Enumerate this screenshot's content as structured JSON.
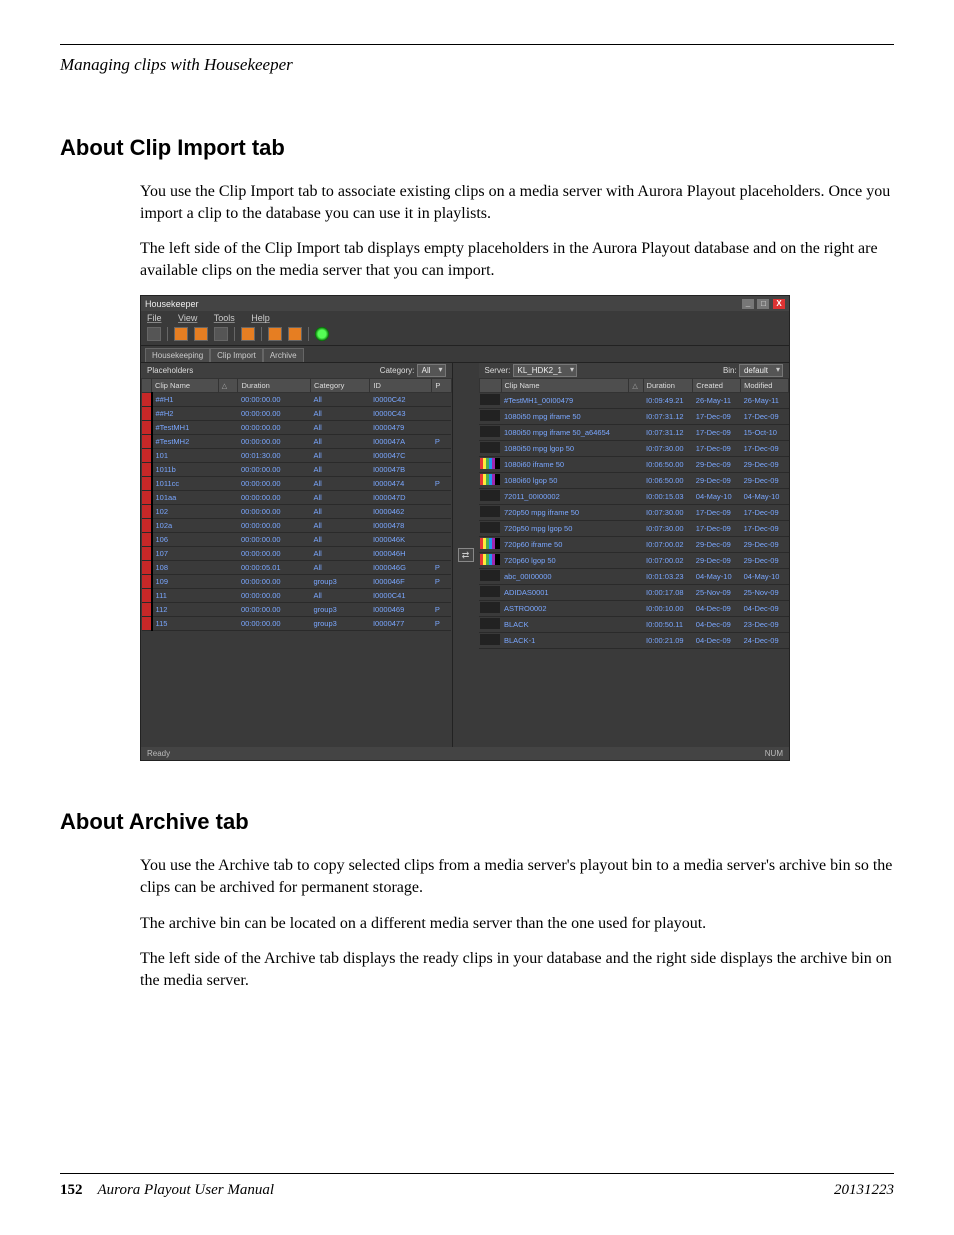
{
  "running_head": "Managing clips with Housekeeper",
  "section1": {
    "title": "About Clip Import tab",
    "p1": "You use the Clip Import tab to associate existing clips on a media server with Aurora Playout placeholders. Once you import a clip to the database you can use it in playlists.",
    "p2": "The left side of the Clip Import tab displays empty placeholders in the Aurora Playout database and on the right are available clips on the media server that you can import."
  },
  "section2": {
    "title": "About Archive tab",
    "p1": "You use the Archive tab to copy selected clips from a media server's playout bin to a media server's archive bin so the clips can be archived for permanent storage.",
    "p2": "The archive bin can be located on a different media server than the one used for playout.",
    "p3": "The left side of the Archive tab displays the ready clips in your database and the right side displays the archive bin on the media server."
  },
  "app": {
    "title": "Housekeeper",
    "menu": [
      "File",
      "View",
      "Tools",
      "Help"
    ],
    "tabs": [
      "Housekeeping",
      "Clip Import",
      "Archive"
    ],
    "left": {
      "label": "Placeholders",
      "category_label": "Category:",
      "category_value": "All",
      "cols": [
        "Clip Name",
        "",
        "Duration",
        "Category",
        "ID",
        "P"
      ],
      "rows": [
        {
          "name": "##H1",
          "dur": "00:00:00.00",
          "cat": "All",
          "id": "I0000C42",
          "p": ""
        },
        {
          "name": "##H2",
          "dur": "00:00:00.00",
          "cat": "All",
          "id": "I0000C43",
          "p": ""
        },
        {
          "name": "#TestMH1",
          "dur": "00:00:00.00",
          "cat": "All",
          "id": "I0000479",
          "p": ""
        },
        {
          "name": "#TestMH2",
          "dur": "00:00:00.00",
          "cat": "All",
          "id": "I000047A",
          "p": "P"
        },
        {
          "name": "101",
          "dur": "00:01:30.00",
          "cat": "All",
          "id": "I000047C",
          "p": ""
        },
        {
          "name": "1011b",
          "dur": "00:00:00.00",
          "cat": "All",
          "id": "I000047B",
          "p": ""
        },
        {
          "name": "1011cc",
          "dur": "00:00:00.00",
          "cat": "All",
          "id": "I0000474",
          "p": "P"
        },
        {
          "name": "101aa",
          "dur": "00:00:00.00",
          "cat": "All",
          "id": "I000047D",
          "p": ""
        },
        {
          "name": "102",
          "dur": "00:00:00.00",
          "cat": "All",
          "id": "I0000462",
          "p": ""
        },
        {
          "name": "102a",
          "dur": "00:00:00.00",
          "cat": "All",
          "id": "I0000478",
          "p": ""
        },
        {
          "name": "106",
          "dur": "00:00:00.00",
          "cat": "All",
          "id": "I000046K",
          "p": ""
        },
        {
          "name": "107",
          "dur": "00:00:00.00",
          "cat": "All",
          "id": "I000046H",
          "p": ""
        },
        {
          "name": "108",
          "dur": "00:00:05.01",
          "cat": "All",
          "id": "I000046G",
          "p": "P"
        },
        {
          "name": "109",
          "dur": "00:00:00.00",
          "cat": "group3",
          "id": "I000046F",
          "p": "P"
        },
        {
          "name": "111",
          "dur": "00:00:00.00",
          "cat": "All",
          "id": "I0000C41",
          "p": ""
        },
        {
          "name": "112",
          "dur": "00:00:00.00",
          "cat": "group3",
          "id": "I0000469",
          "p": "P"
        },
        {
          "name": "115",
          "dur": "00:00:00.00",
          "cat": "group3",
          "id": "I0000477",
          "p": "P"
        }
      ]
    },
    "right": {
      "server_label": "Server:",
      "server_value": "KL_HDK2_1",
      "bin_label": "Bin:",
      "bin_value": "default",
      "cols": [
        "Clip Name",
        "",
        "Duration",
        "Created",
        "Modified"
      ],
      "rows": [
        {
          "name": "#TestMH1_00I00479",
          "dur": "I0:09:49.21",
          "cre": "26-May-11",
          "mod": "26-May-11",
          "th": ""
        },
        {
          "name": "1080i50 mpg iframe 50",
          "dur": "I0:07:31.12",
          "cre": "17-Dec-09",
          "mod": "17-Dec-09",
          "th": ""
        },
        {
          "name": "1080i50 mpg iframe 50_a64654",
          "dur": "I0:07:31.12",
          "cre": "17-Dec-09",
          "mod": "15-Oct-10",
          "th": ""
        },
        {
          "name": "1080i50 mpg lgop 50",
          "dur": "I0:07:30.00",
          "cre": "17-Dec-09",
          "mod": "17-Dec-09",
          "th": ""
        },
        {
          "name": "1080i60 iframe 50",
          "dur": "I0:06:50.00",
          "cre": "29-Dec-09",
          "mod": "29-Dec-09",
          "th": "bars"
        },
        {
          "name": "1080i60 lgop 50",
          "dur": "I0:06:50.00",
          "cre": "29-Dec-09",
          "mod": "29-Dec-09",
          "th": "bars"
        },
        {
          "name": "72011_00I00002",
          "dur": "I0:00:15.03",
          "cre": "04-May-10",
          "mod": "04-May-10",
          "th": ""
        },
        {
          "name": "720p50 mpg iframe 50",
          "dur": "I0:07:30.00",
          "cre": "17-Dec-09",
          "mod": "17-Dec-09",
          "th": ""
        },
        {
          "name": "720p50 mpg lgop 50",
          "dur": "I0:07:30.00",
          "cre": "17-Dec-09",
          "mod": "17-Dec-09",
          "th": ""
        },
        {
          "name": "720p60 iframe 50",
          "dur": "I0:07:00.02",
          "cre": "29-Dec-09",
          "mod": "29-Dec-09",
          "th": "bars"
        },
        {
          "name": "720p60 lgop 50",
          "dur": "I0:07:00.02",
          "cre": "29-Dec-09",
          "mod": "29-Dec-09",
          "th": "bars"
        },
        {
          "name": "abc_00I00000",
          "dur": "I0:01:03.23",
          "cre": "04-May-10",
          "mod": "04-May-10",
          "th": ""
        },
        {
          "name": "ADIDAS0001",
          "dur": "I0:00:17.08",
          "cre": "25-Nov-09",
          "mod": "25-Nov-09",
          "th": ""
        },
        {
          "name": "ASTRO0002",
          "dur": "I0:00:10.00",
          "cre": "04-Dec-09",
          "mod": "04-Dec-09",
          "th": ""
        },
        {
          "name": "BLACK",
          "dur": "I0:00:50.11",
          "cre": "04-Dec-09",
          "mod": "23-Dec-09",
          "th": ""
        },
        {
          "name": "BLACK-1",
          "dur": "I0:00:21.09",
          "cre": "04-Dec-09",
          "mod": "24-Dec-09",
          "th": ""
        }
      ]
    },
    "status_left": "Ready",
    "status_right": "NUM"
  },
  "footer": {
    "page": "152",
    "doc": "Aurora Playout   User Manual",
    "date": "20131223"
  }
}
